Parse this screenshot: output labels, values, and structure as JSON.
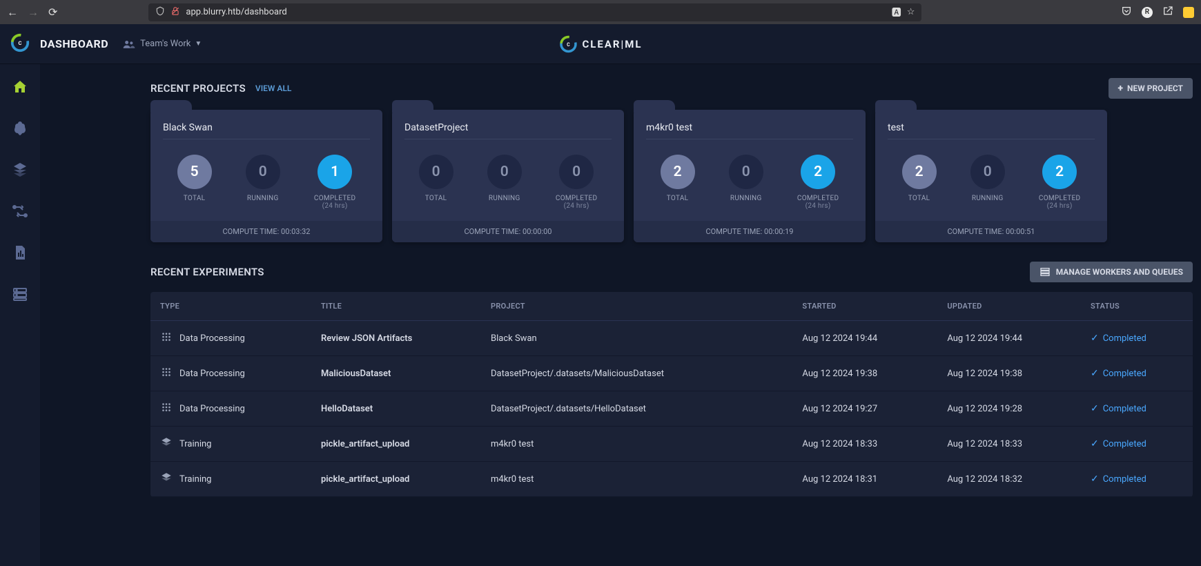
{
  "browser": {
    "url": "app.blurry.htb/dashboard"
  },
  "topbar": {
    "title": "DASHBOARD",
    "workspace_label": "Team's Work",
    "brand": "CLEAR|ML"
  },
  "projects_section": {
    "title": "RECENT PROJECTS",
    "view_all": "VIEW ALL",
    "new_project": "NEW PROJECT",
    "stat_labels": {
      "total": "TOTAL",
      "running": "RUNNING",
      "completed": "COMPLETED",
      "completed_sub": "(24 hrs)"
    },
    "compute_prefix": "COMPUTE TIME: ",
    "cards": [
      {
        "name": "Black Swan",
        "total": 5,
        "running": 0,
        "completed": 1,
        "compute": "00:03:32"
      },
      {
        "name": "DatasetProject",
        "total": 0,
        "running": 0,
        "completed": 0,
        "compute": "00:00:00"
      },
      {
        "name": "m4kr0 test",
        "total": 2,
        "running": 0,
        "completed": 2,
        "compute": "00:00:19"
      },
      {
        "name": "test",
        "total": 2,
        "running": 0,
        "completed": 2,
        "compute": "00:00:51"
      }
    ]
  },
  "experiments_section": {
    "title": "RECENT EXPERIMENTS",
    "manage_btn": "MANAGE WORKERS AND QUEUES",
    "columns": {
      "type": "TYPE",
      "title": "TITLE",
      "project": "PROJECT",
      "started": "STARTED",
      "updated": "UPDATED",
      "status": "STATUS"
    },
    "rows": [
      {
        "type": "Data Processing",
        "type_icon": "data",
        "title": "Review JSON Artifacts",
        "project": "Black Swan",
        "started": "Aug 12 2024 19:44",
        "updated": "Aug 12 2024 19:44",
        "status": "Completed"
      },
      {
        "type": "Data Processing",
        "type_icon": "data",
        "title": "MaliciousDataset",
        "project": "DatasetProject/.datasets/MaliciousDataset",
        "started": "Aug 12 2024 19:38",
        "updated": "Aug 12 2024 19:38",
        "status": "Completed"
      },
      {
        "type": "Data Processing",
        "type_icon": "data",
        "title": "HelloDataset",
        "project": "DatasetProject/.datasets/HelloDataset",
        "started": "Aug 12 2024 19:27",
        "updated": "Aug 12 2024 19:28",
        "status": "Completed"
      },
      {
        "type": "Training",
        "type_icon": "train",
        "title": "pickle_artifact_upload",
        "project": "m4kr0 test",
        "started": "Aug 12 2024 18:33",
        "updated": "Aug 12 2024 18:33",
        "status": "Completed"
      },
      {
        "type": "Training",
        "type_icon": "train",
        "title": "pickle_artifact_upload",
        "project": "m4kr0 test",
        "started": "Aug 12 2024 18:31",
        "updated": "Aug 12 2024 18:32",
        "status": "Completed"
      }
    ]
  }
}
